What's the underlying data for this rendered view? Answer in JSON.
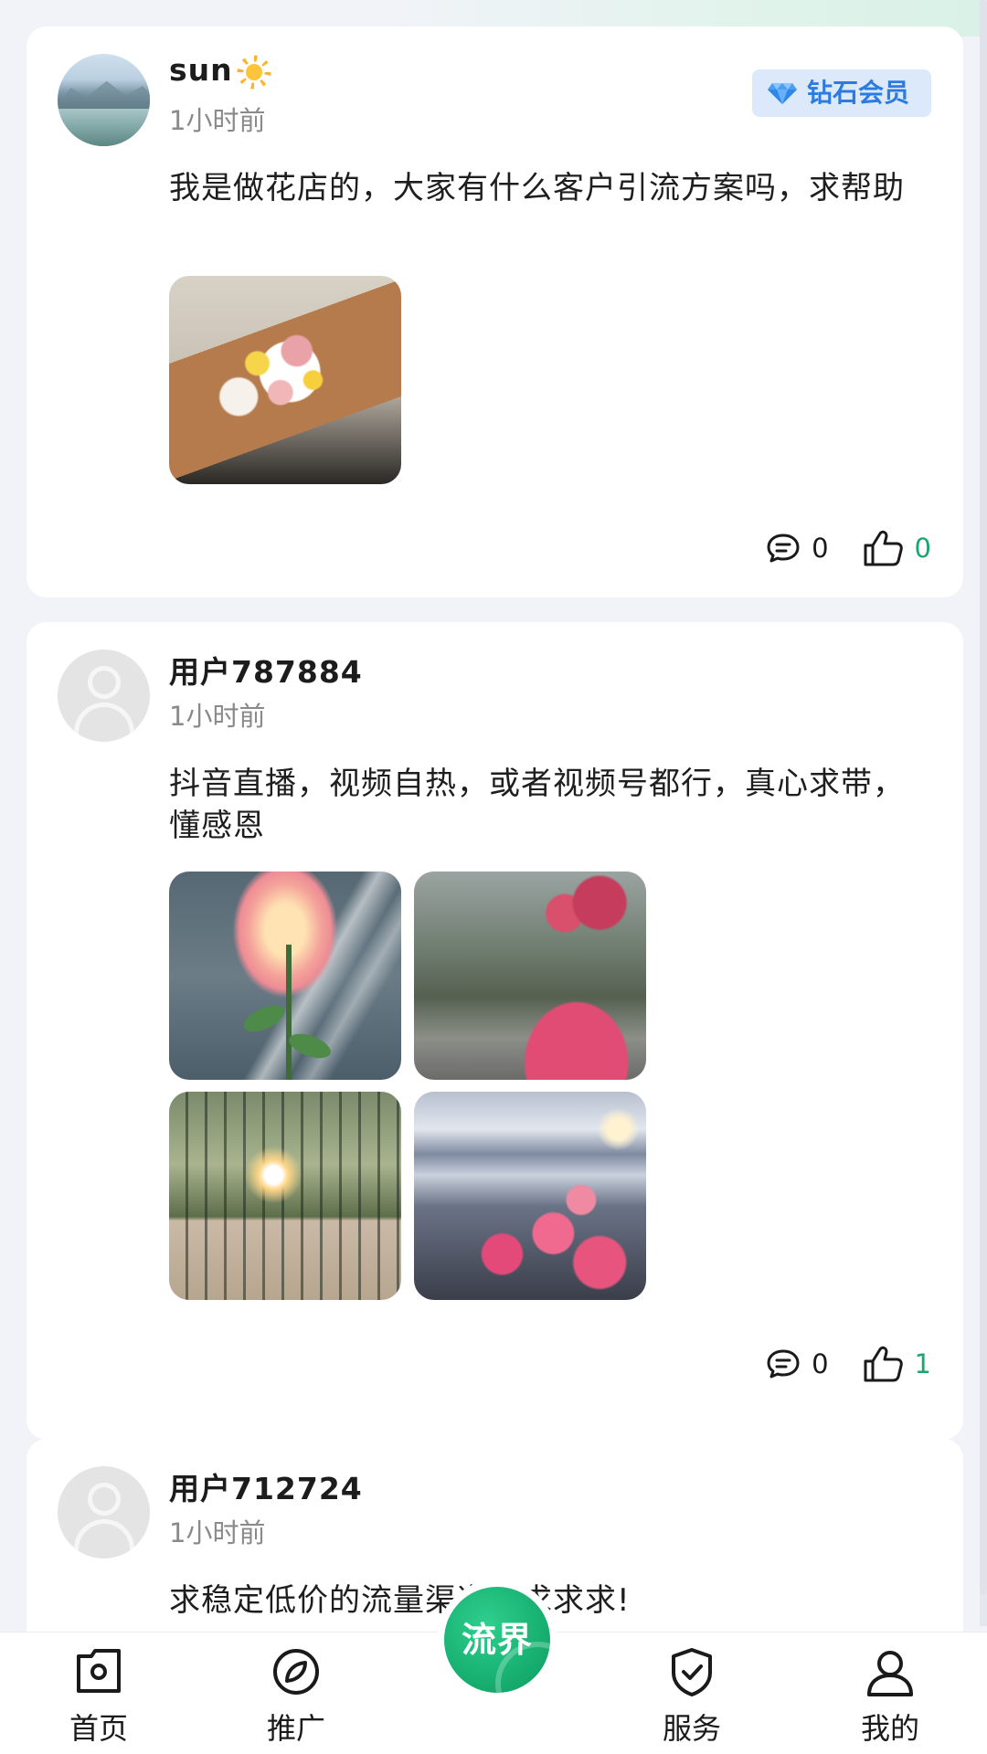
{
  "posts": [
    {
      "user": "sun",
      "user_emoji": "sun-icon",
      "time": "1小时前",
      "badge": "钻石会员",
      "text": "我是做花店的，大家有什么客户引流方案吗，求帮助",
      "comments": "0",
      "likes": "0"
    },
    {
      "user": "用户787884",
      "time": "1小时前",
      "text": "抖音直播，视频自热，或者视频号都行，真心求带，懂感恩",
      "comments": "0",
      "likes": "1"
    },
    {
      "user": "用户712724",
      "time": "1小时前",
      "text": "求稳定低价的流量渠道，求求求!"
    }
  ],
  "nav": {
    "home": "首页",
    "promote": "推广",
    "center": "流界",
    "service": "服务",
    "me": "我的"
  },
  "colors": {
    "accent": "#17a870",
    "badge_bg": "#dbe9fb",
    "badge_text": "#2b7be0",
    "background": "#f1f3f8"
  }
}
